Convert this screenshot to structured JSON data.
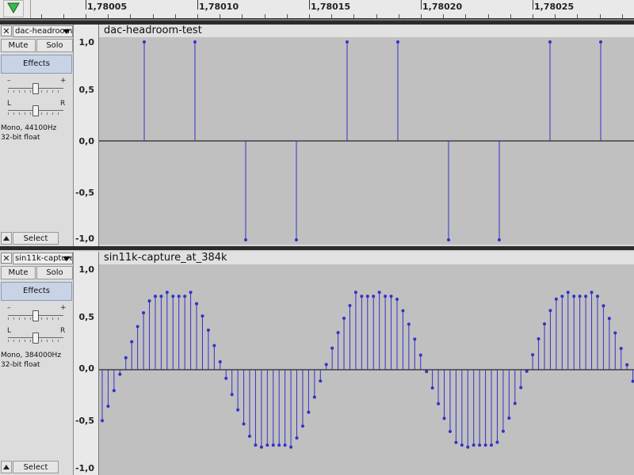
{
  "timeline": {
    "ticks": [
      {
        "label": "1,78005"
      },
      {
        "label": "1,78010"
      },
      {
        "label": "1,78015"
      },
      {
        "label": "1,78020"
      },
      {
        "label": "1,78025"
      }
    ]
  },
  "tracks": [
    {
      "close_label": "✕",
      "name": "dac-headroom-test",
      "mute_label": "Mute",
      "solo_label": "Solo",
      "effects_label": "Effects",
      "gain_minus": "–",
      "gain_plus": "+",
      "pan_left": "L",
      "pan_right": "R",
      "info_line1": "Mono, 44100Hz",
      "info_line2": "32-bit float",
      "select_label": "Select",
      "title": "dac-headroom-test",
      "ruler_labels": {
        "top": "1,0",
        "upper_mid": "0,5",
        "zero": "0,0",
        "lower_mid": "-0,5",
        "bottom": "-1,0"
      },
      "waveform_color": "#3232c8",
      "background_color": "#c0c0c0"
    },
    {
      "close_label": "✕",
      "name": "sin11k-capture_at_384k",
      "mute_label": "Mute",
      "solo_label": "Solo",
      "effects_label": "Effects",
      "gain_minus": "–",
      "gain_plus": "+",
      "pan_left": "L",
      "pan_right": "R",
      "info_line1": "Mono, 384000Hz",
      "info_line2": "32-bit float",
      "select_label": "Select",
      "title": "sin11k-capture_at_384k",
      "ruler_labels": {
        "top": "1,0",
        "upper_mid": "0,5",
        "zero": "0,0",
        "lower_mid": "-0,5",
        "bottom": "-1,0"
      },
      "waveform_color": "#3232c8",
      "background_color": "#c0c0c0"
    }
  ],
  "icons": {
    "play_head": "green-triangle-down-icon",
    "collapse": "triangle-up-icon",
    "dropdown": "chevron-down-icon"
  }
}
